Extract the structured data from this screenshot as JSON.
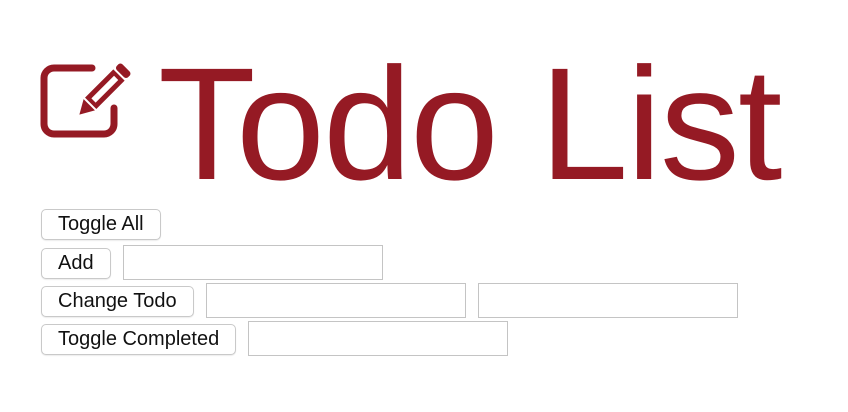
{
  "header": {
    "title": "Todo List",
    "brand_color": "#951a24",
    "icon": "edit-pencil-icon"
  },
  "controls": {
    "toggle_all_label": "Toggle All",
    "add_label": "Add",
    "add_input_value": "",
    "change_todo_label": "Change Todo",
    "change_position_value": "",
    "change_text_value": "",
    "toggle_completed_label": "Toggle Completed",
    "toggle_completed_value": ""
  }
}
